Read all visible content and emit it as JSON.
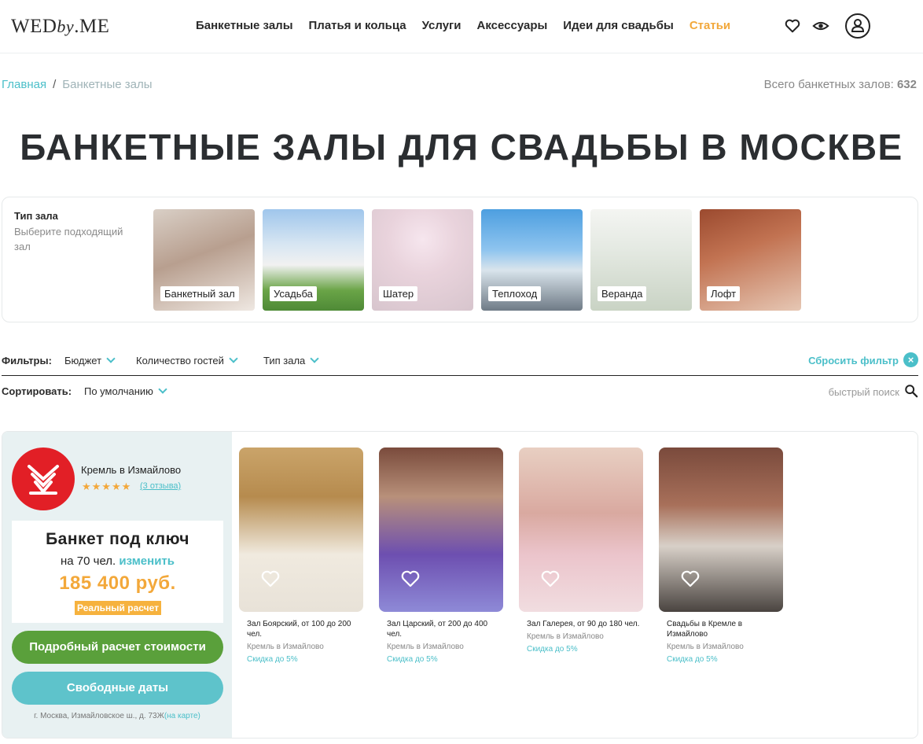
{
  "header": {
    "logo": {
      "part1": "WED",
      "part2": "by",
      "part3": ".ME"
    },
    "nav": [
      "Банкетные залы",
      "Платья и кольца",
      "Услуги",
      "Аксессуары",
      "Идеи для свадьбы",
      "Статьи"
    ],
    "nav_accent_color": "#f2a83b"
  },
  "breadcrumbs": {
    "home": "Главная",
    "separator": "/",
    "current": "Банкетные залы"
  },
  "total": {
    "label": "Всего банкетных залов:",
    "count": "632"
  },
  "page_title": "БАНКЕТНЫЕ ЗАЛЫ ДЛЯ СВАДЬБЫ В МОСКВЕ",
  "hall_type": {
    "title": "Тип зала",
    "subtitle": "Выберите подходящий зал",
    "tiles": [
      "Банкетный зал",
      "Усадьба",
      "Шатер",
      "Теплоход",
      "Веранда",
      "Лофт"
    ]
  },
  "filters": {
    "label": "Фильтры:",
    "items": [
      "Бюджет",
      "Количество гостей",
      "Тип зала"
    ],
    "reset": "Сбросить фильтр"
  },
  "sort": {
    "label": "Сортировать:",
    "value": "По умолчанию",
    "quick_search": "быстрый поиск"
  },
  "venue": {
    "name": "Кремль в Измайлово",
    "stars": "★★★★★",
    "rating": 5,
    "reviews": "(3 отзыва)",
    "price_box": {
      "title": "Банкет под ключ",
      "guests": "на 70 чел.",
      "change": "изменить",
      "price": "185 400 руб.",
      "badge": "Реальный расчет"
    },
    "btn_calc": "Подробный расчет стоимости",
    "btn_dates": "Свободные даты",
    "address": "г. Москва, Измайловское ш., д. 73Ж",
    "map_link": "(на карте)",
    "halls": [
      {
        "name": "Зал Боярский, от 100 до 200 чел.",
        "venue": "Кремль в Измайлово",
        "discount": "Скидка до 5%"
      },
      {
        "name": "Зал Царский, от 200 до 400 чел.",
        "venue": "Кремль в Измайлово",
        "discount": "Скидка до 5%"
      },
      {
        "name": "Зал Галерея, от 90 до 180 чел.",
        "venue": "Кремль в Измайлово",
        "discount": "Скидка до 5%"
      },
      {
        "name": "Свадьбы в Кремле в Измайлово",
        "venue": "Кремль в Измайлово",
        "discount": "Скидка до 5%"
      }
    ]
  },
  "colors": {
    "teal": "#4bbfc9",
    "orange": "#f3a83a",
    "green": "#5aa03b",
    "red": "#e21f26"
  }
}
